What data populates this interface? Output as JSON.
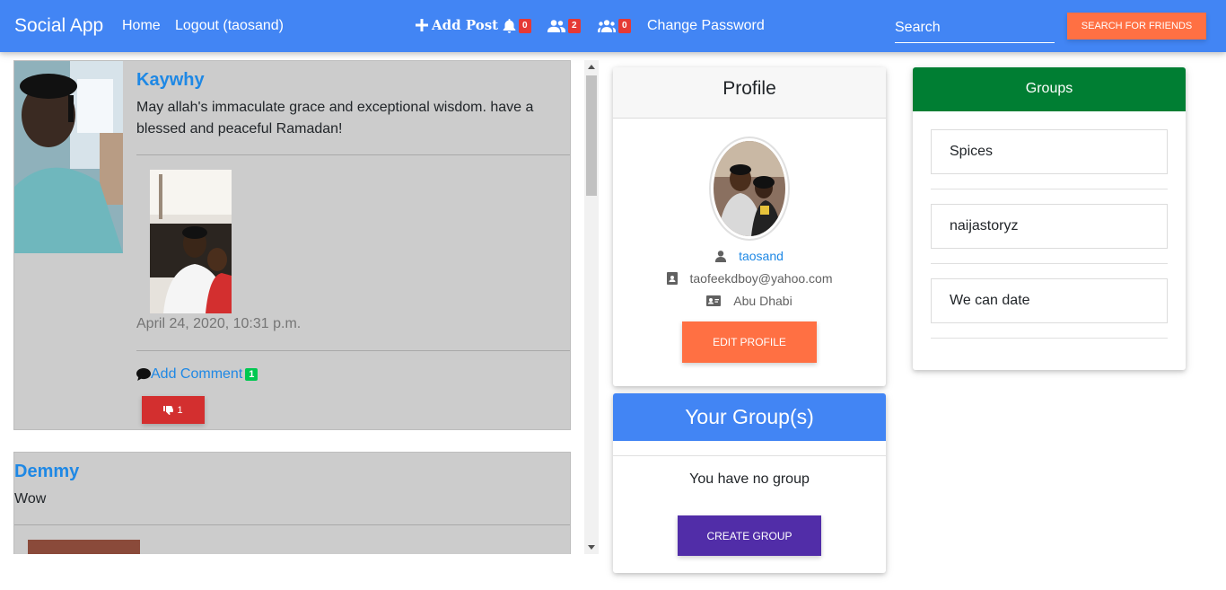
{
  "nav": {
    "brand": "Social App",
    "home": "Home",
    "logout": "Logout (taosand)",
    "add_post": "Add Post",
    "notifications_count": "0",
    "friend_requests_count": "2",
    "groups_count": "0",
    "change_password": "Change Password",
    "search_placeholder": "Search",
    "search_button": "SEARCH FOR FRIENDS"
  },
  "posts": [
    {
      "author": "Kaywhy",
      "text": "May allah's immaculate grace and exceptional wisdom. have a blessed and peaceful Ramadan!",
      "date": "April 24, 2020, 10:31 p.m.",
      "add_comment": "Add Comment",
      "comment_count": "1",
      "dislike_count": "1"
    },
    {
      "author": "Demmy",
      "text": "Wow"
    }
  ],
  "profile": {
    "title": "Profile",
    "username": "taosand",
    "email": "taofeekdboy@yahoo.com",
    "location": "Abu Dhabi",
    "edit_button": "EDIT PROFILE"
  },
  "your_groups": {
    "title": "Your Group(s)",
    "empty_text": "You have no group",
    "create_button": "CREATE GROUP"
  },
  "groups": {
    "title": "Groups",
    "items": [
      "Spices",
      "naijastoryz",
      "We can date"
    ]
  },
  "colors": {
    "navbar": "#4285f4",
    "accent_orange": "#ff7043",
    "groups_header": "#007e33",
    "create_group": "#512da8",
    "dislike": "#d32f2f",
    "link_blue": "#1e88e5"
  }
}
